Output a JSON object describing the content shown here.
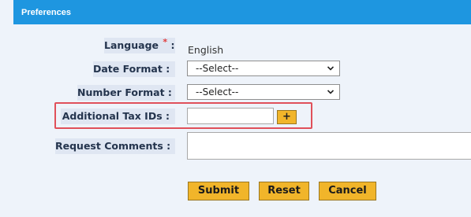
{
  "panel": {
    "title": "Preferences"
  },
  "form": {
    "language": {
      "label": "Language",
      "required_mark": "*",
      "colon": ":",
      "value": "English"
    },
    "date_format": {
      "label": "Date Format :",
      "selected": "--Select--"
    },
    "number_format": {
      "label": "Number Format :",
      "selected": "--Select--"
    },
    "additional_tax_ids": {
      "label": "Additional Tax IDs :",
      "value": "",
      "add_label": "+"
    },
    "request_comments": {
      "label": "Request Comments :",
      "value": ""
    }
  },
  "buttons": {
    "submit": "Submit",
    "reset": "Reset",
    "cancel": "Cancel"
  },
  "colors": {
    "header": "#1e96e0",
    "button": "#f1b52a",
    "highlight": "#e0505a",
    "label_bg": "#dfe6f2"
  }
}
